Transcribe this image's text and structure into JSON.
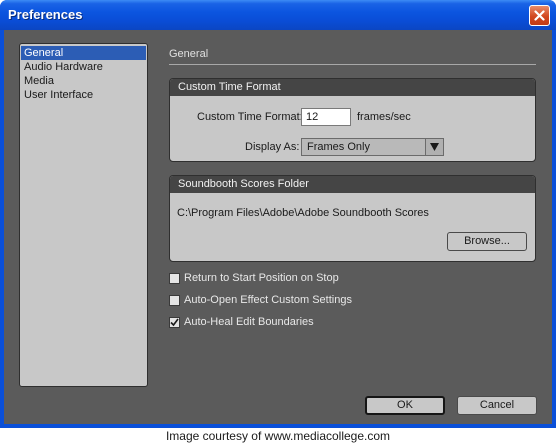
{
  "window": {
    "title": "Preferences"
  },
  "sidebar": {
    "items": [
      {
        "label": "General",
        "selected": true
      },
      {
        "label": "Audio Hardware",
        "selected": false
      },
      {
        "label": "Media",
        "selected": false
      },
      {
        "label": "User Interface",
        "selected": false
      }
    ]
  },
  "main": {
    "section_title": "General",
    "custom_time": {
      "header": "Custom Time Format",
      "field_label": "Custom Time Format:",
      "field_value": "12",
      "field_unit": "frames/sec",
      "display_label": "Display As:",
      "display_value": "Frames Only"
    },
    "scores_folder": {
      "header": "Soundbooth Scores Folder",
      "path": "C:\\Program Files\\Adobe\\Adobe Soundbooth Scores",
      "browse_label": "Browse..."
    },
    "options": [
      {
        "label": "Return to Start Position on Stop",
        "checked": false
      },
      {
        "label": "Auto-Open Effect Custom Settings",
        "checked": false
      },
      {
        "label": "Auto-Heal Edit Boundaries",
        "checked": true
      }
    ]
  },
  "footer": {
    "ok_label": "OK",
    "cancel_label": "Cancel"
  },
  "caption": "Image courtesy of www.mediacollege.com",
  "colors": {
    "titlebar": "#0a4fd8",
    "client_bg": "#5b5b5b",
    "panel_bg": "#c8c8c8",
    "panel_header": "#454545",
    "selection": "#2c5db5"
  }
}
